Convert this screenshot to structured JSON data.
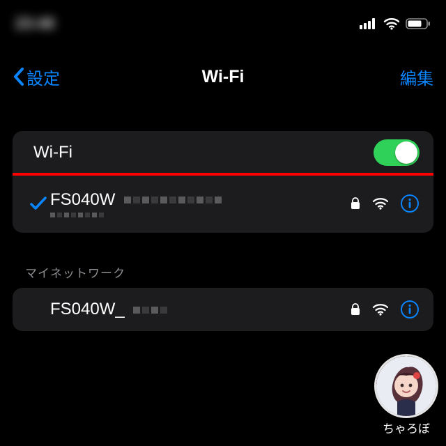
{
  "status": {
    "time": "23:48"
  },
  "nav": {
    "back": "設定",
    "title": "Wi-Fi",
    "edit": "編集"
  },
  "toggle_row": {
    "label": "Wi-Fi",
    "on": true
  },
  "connected": {
    "ssid": "FS040W"
  },
  "section_header": "マイネットワーク",
  "networks": [
    {
      "ssid": "FS040W_"
    }
  ],
  "avatar": {
    "label": "ちゃろぼ"
  },
  "icons": {
    "chevron_left": "chevron-left-icon",
    "check": "check-icon",
    "lock": "lock-icon",
    "wifi": "wifi-icon",
    "info": "info-icon",
    "signal": "cell-signal-icon",
    "battery": "battery-icon"
  },
  "colors": {
    "accent": "#0a84ff",
    "toggle_on": "#30d158",
    "highlight": "#ff0000"
  }
}
